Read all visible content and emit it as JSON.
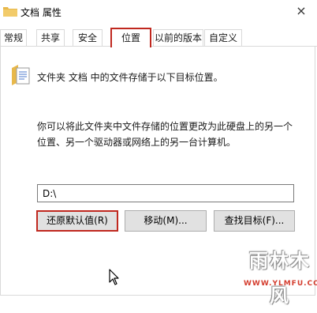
{
  "window": {
    "title": "文档 属性",
    "close_glyph": "×"
  },
  "tabs": [
    {
      "label": "常规"
    },
    {
      "label": "共享"
    },
    {
      "label": "安全"
    },
    {
      "label": "位置",
      "active": true
    },
    {
      "label": "以前的版本"
    },
    {
      "label": "自定义"
    }
  ],
  "location": {
    "description": "文件夹 文档 中的文件存储于以下目标位置。",
    "info_line1": "你可以将此文件夹中文件存储的位置更改为此硬盘上的另一个",
    "info_line2": "位置、另一个驱动器或网络上的另一台计算机。",
    "path_value": "D:\\"
  },
  "buttons": {
    "restore_default": "还原默认值(R)",
    "move": "移动(M)...",
    "find_target": "查找目标(F)..."
  },
  "watermark": {
    "main": "雨林木风",
    "url": "WWW.YLMFU.COM"
  },
  "colors": {
    "highlight": "#c0281f",
    "folder": "#e8b84a",
    "button_bg": "#e1e1e1",
    "watermark_url": "#d43d2e"
  },
  "icons": [
    "folder-document-icon",
    "close-icon",
    "mouse-cursor-icon"
  ]
}
